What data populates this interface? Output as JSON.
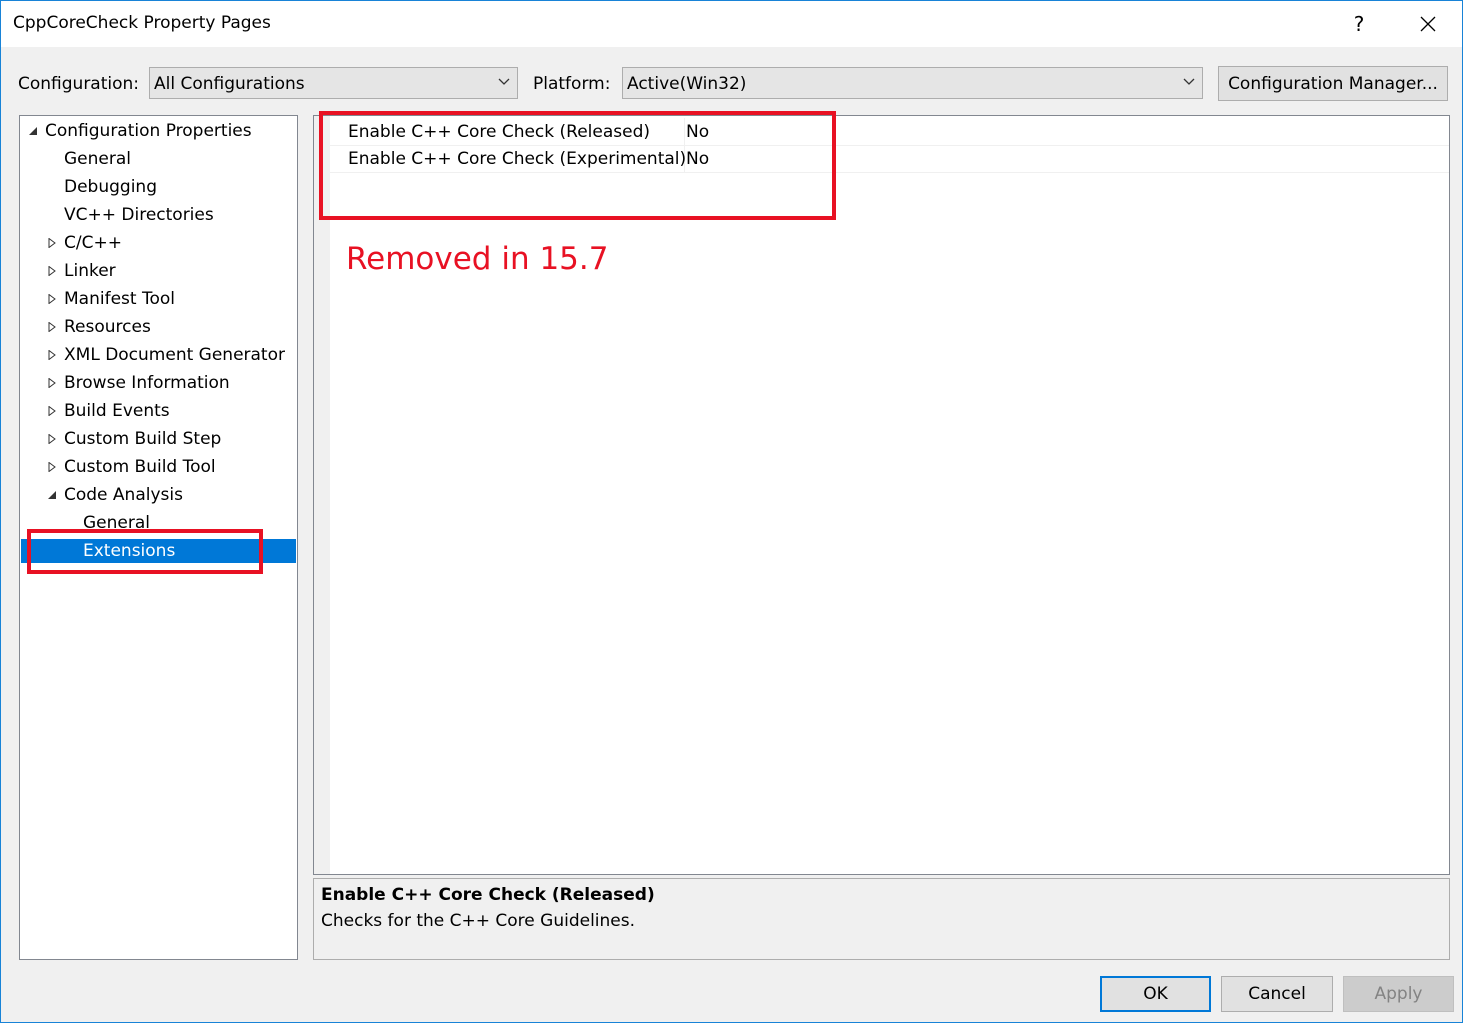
{
  "window": {
    "title": "CppCoreCheck Property Pages",
    "help_label": "?",
    "close_label": "✕",
    "accent_color": "#0078d7"
  },
  "toolbar": {
    "configuration_label": "Configuration:",
    "configuration_value": "All Configurations",
    "platform_label": "Platform:",
    "platform_value": "Active(Win32)",
    "config_manager_label": "Configuration Manager..."
  },
  "tree": {
    "items": [
      {
        "label": "Configuration Properties",
        "state": "expanded"
      },
      {
        "label": "General"
      },
      {
        "label": "Debugging"
      },
      {
        "label": "VC++ Directories"
      },
      {
        "label": "C/C++",
        "state": "collapsed"
      },
      {
        "label": "Linker",
        "state": "collapsed"
      },
      {
        "label": "Manifest Tool",
        "state": "collapsed"
      },
      {
        "label": "Resources",
        "state": "collapsed"
      },
      {
        "label": "XML Document Generator",
        "state": "collapsed"
      },
      {
        "label": "Browse Information",
        "state": "collapsed"
      },
      {
        "label": "Build Events",
        "state": "collapsed"
      },
      {
        "label": "Custom Build Step",
        "state": "collapsed"
      },
      {
        "label": "Custom Build Tool",
        "state": "collapsed"
      },
      {
        "label": "Code Analysis",
        "state": "expanded"
      },
      {
        "label": "General"
      },
      {
        "label": "Extensions",
        "selected": true
      }
    ]
  },
  "properties": [
    {
      "name": "Enable C++ Core Check (Released)",
      "value": "No"
    },
    {
      "name": "Enable C++ Core Check (Experimental)",
      "value": "No"
    }
  ],
  "annotation": {
    "text": "Removed in 15.7",
    "color": "#e81123"
  },
  "description": {
    "title": "Enable C++ Core Check (Released)",
    "text": "Checks for the C++ Core Guidelines."
  },
  "footer": {
    "ok_label": "OK",
    "cancel_label": "Cancel",
    "apply_label": "Apply"
  }
}
